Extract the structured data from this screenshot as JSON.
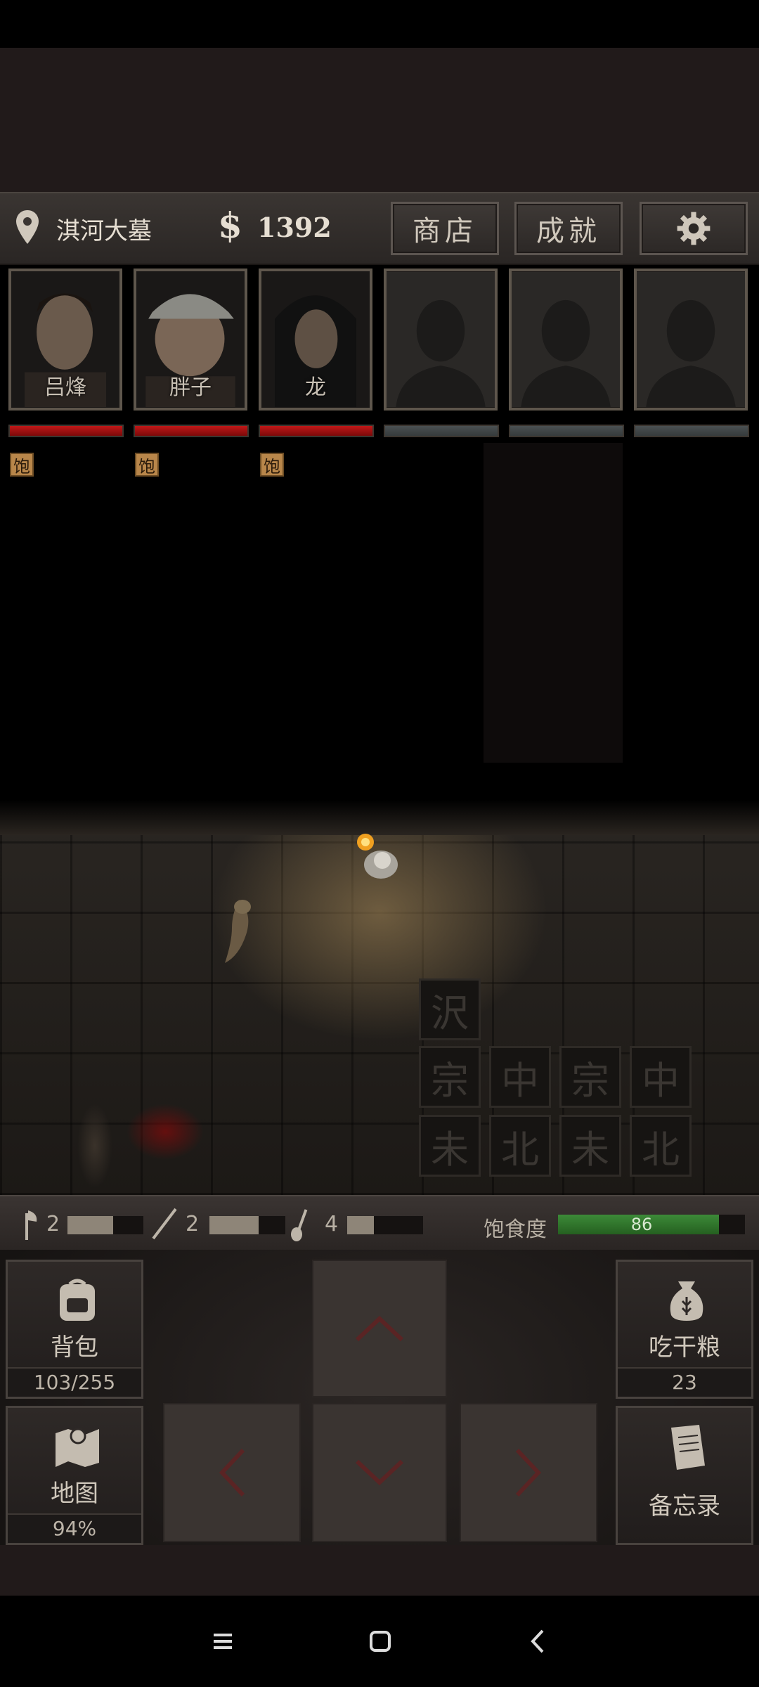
{
  "header": {
    "location": "淇河大墓",
    "currency_symbol": "$",
    "money": "1392",
    "shop_label": "商店",
    "achievements_label": "成就",
    "settings_icon": "gear-icon"
  },
  "party": [
    {
      "name": "吕烽",
      "hp": 1.0,
      "status": "饱",
      "filled": true
    },
    {
      "name": "胖子",
      "hp": 1.0,
      "status": "饱",
      "filled": true
    },
    {
      "name": "龙",
      "hp": 1.0,
      "status": "饱",
      "filled": true
    },
    {
      "name": "",
      "hp": 0,
      "status": "",
      "filled": false
    },
    {
      "name": "",
      "hp": 0,
      "status": "",
      "filled": false
    },
    {
      "name": "",
      "hp": 0,
      "status": "",
      "filled": false
    }
  ],
  "tools": [
    {
      "icon": "axe-icon",
      "count": "2",
      "durability": 0.6
    },
    {
      "icon": "pickaxe-icon",
      "count": "2",
      "durability": 0.65
    },
    {
      "icon": "shovel-icon",
      "count": "4",
      "durability": 0.35
    }
  ],
  "satiety": {
    "label": "饱食度",
    "value": "86",
    "level": 0.86
  },
  "controls": {
    "backpack_label": "背包",
    "backpack_count": "103/255",
    "map_label": "地图",
    "map_percent": "94%",
    "eat_label": "吃干粮",
    "eat_count": "23",
    "memo_label": "备忘录"
  },
  "colors": {
    "hp_full": "#c01818",
    "hp_empty": "#4a5052",
    "satiety": "#3c8a38",
    "badge": "#b8864a"
  }
}
